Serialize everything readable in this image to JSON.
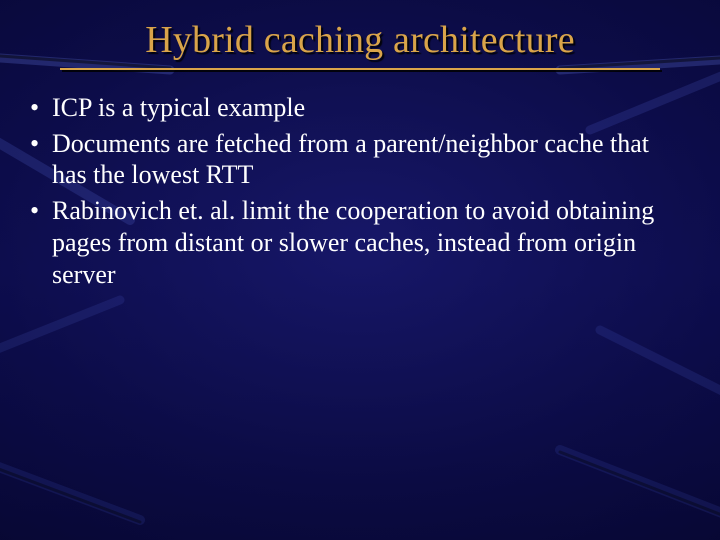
{
  "title": "Hybrid caching architecture",
  "bullets": [
    "ICP is a typical example",
    "Documents are fetched from a parent/neighbor cache that has the lowest RTT",
    "Rabinovich et. al. limit the cooperation to avoid obtaining pages from distant or slower caches, instead from origin server"
  ]
}
